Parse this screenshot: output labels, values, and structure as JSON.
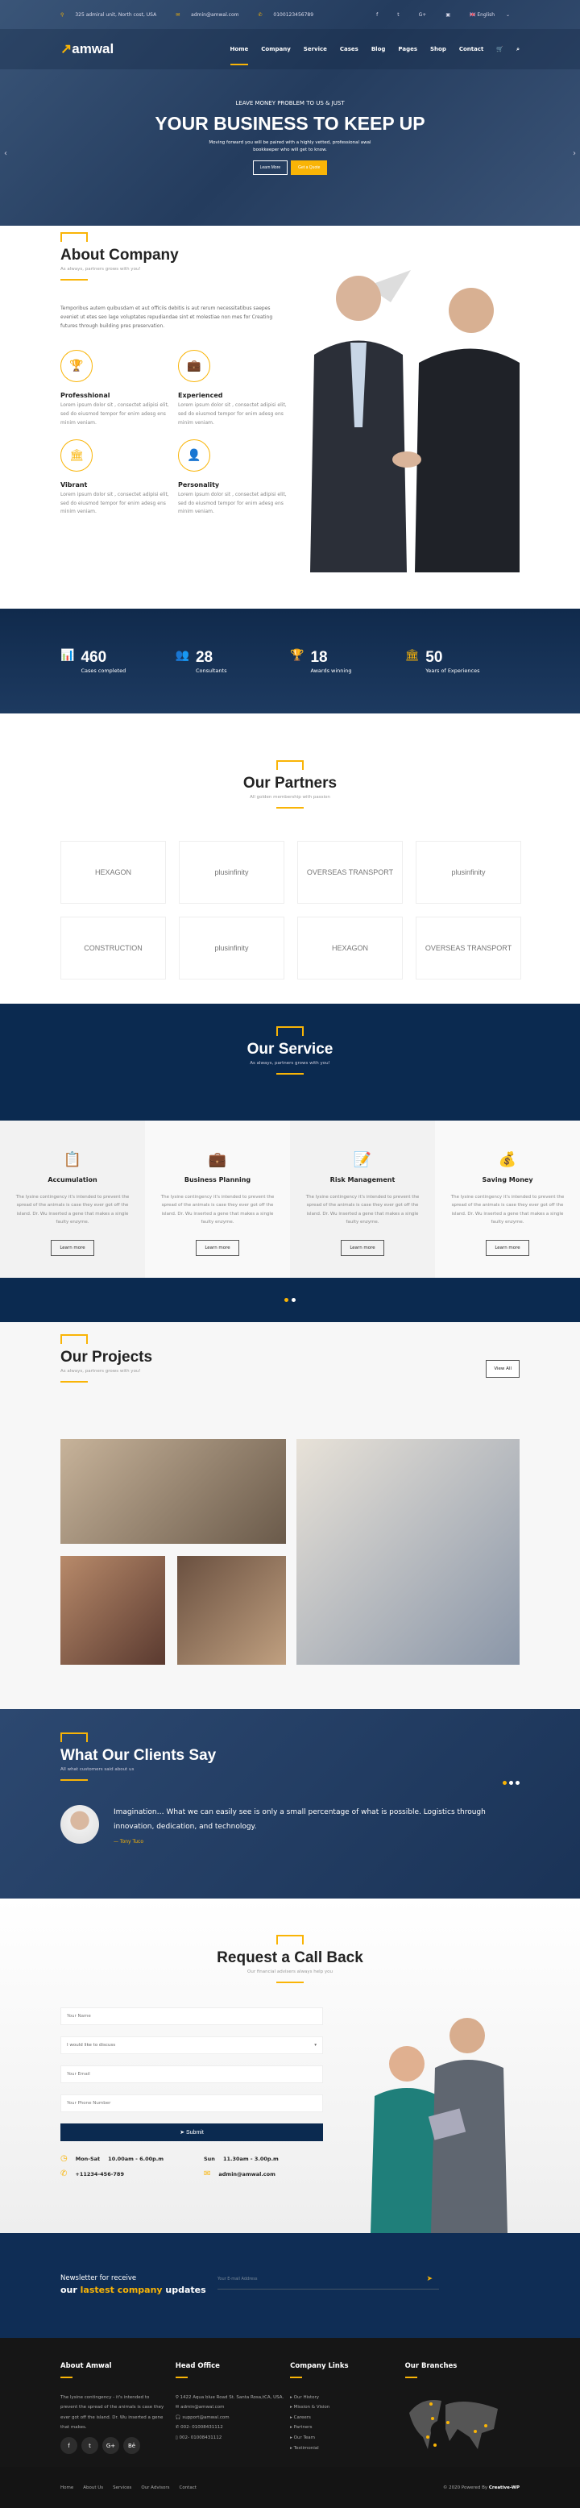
{
  "topbar": {
    "address": "325 admiral unit, North cost, USA",
    "email": "admin@amwal.com",
    "phone": "0100123456789",
    "social": [
      "f",
      "t",
      "G+",
      "▣"
    ],
    "language": "English"
  },
  "nav": {
    "logo": "amwal",
    "items": [
      "Home",
      "Company",
      "Service",
      "Cases",
      "Blog",
      "Pages",
      "Shop",
      "Contact"
    ],
    "active": "Home"
  },
  "hero": {
    "subtitle": "LEAVE MONEY PROBLEM TO US & JUST",
    "title": "YOUR BUSINESS TO KEEP UP",
    "text": "Moving forward you will be paired with a highly vetted, professional awal bookkeeper who will get to know.",
    "btn_learn": "Learn More",
    "btn_quote": "Get a Quote"
  },
  "about": {
    "title": "About Company",
    "subtitle": "As always, partners grows with you!",
    "text": "Temporibus autem quibusdam et aut officiis debitis is aut rerum necessitatibus saepes eveniet ut etes seo lage voluptates repudiandae sint et molestiae non mes for Creating futures through building pres preservation.",
    "features": [
      {
        "icon": "trophy-icon",
        "title": "Professhional",
        "text": "Lorem ipsum dolor sit , consectet adipisi elit, sed do eiusmod tempor for enim adesg ens minim veniam."
      },
      {
        "icon": "briefcase-icon",
        "title": "Experienced",
        "text": "Lorem ipsum dolor sit , consectet adipisi elit, sed do eiusmod tempor for enim adesg ens minim veniam."
      },
      {
        "icon": "bank-icon",
        "title": "Vibrant",
        "text": "Lorem ipsum dolor sit , consectet adipisi elit, sed do eiusmod tempor for enim adesg ens minim veniam."
      },
      {
        "icon": "person-icon",
        "title": "Personality",
        "text": "Lorem ipsum dolor sit , consectet adipisi elit, sed do eiusmod tempor for enim adesg ens minim veniam."
      }
    ]
  },
  "stats": [
    {
      "icon": "chart-icon",
      "value": "460",
      "label": "Cases completed"
    },
    {
      "icon": "users-icon",
      "value": "28",
      "label": "Consultants"
    },
    {
      "icon": "trophy-icon",
      "value": "18",
      "label": "Awards winning"
    },
    {
      "icon": "bank-icon",
      "value": "50",
      "label": "Years of Experiences"
    }
  ],
  "partners": {
    "title": "Our Partners",
    "subtitle": "All golden membership with passion",
    "logos": [
      "HEXAGON",
      "plusinfinity",
      "OVERSEAS TRANSPORT",
      "plusinfinity",
      "CONSTRUCTION",
      "plusinfinity",
      "HEXAGON",
      "OVERSEAS TRANSPORT"
    ]
  },
  "service": {
    "title": "Our Service",
    "subtitle": "As always, partners grows with you!",
    "button": "Learn more",
    "cards": [
      {
        "title": "Accumulation",
        "text": "The lysine contingency it's intended to prevent the spread of the animals is case they ever got off the island. Dr. Wu inserted a gene that makes a single faulty enzyme."
      },
      {
        "title": "Business Planning",
        "text": "The lysine contingency it's intended to prevent the spread of the animals is case they ever got off the island. Dr. Wu inserted a gene that makes a single faulty enzyme."
      },
      {
        "title": "Risk Management",
        "text": "The lysine contingency it's intended to prevent the spread of the animals is case they ever got off the island. Dr. Wu inserted a gene that makes a single faulty enzyme."
      },
      {
        "title": "Saving Money",
        "text": "The lysine contingency it's intended to prevent the spread of the animals is case they ever got off the island. Dr. Wu inserted a gene that makes a single faulty enzyme."
      }
    ]
  },
  "projects": {
    "title": "Our Projects",
    "subtitle": "As always, partners grows with you!",
    "view_all": "View All"
  },
  "clients": {
    "title": "What Our Clients Say",
    "subtitle": "All what customers said about us",
    "quote": "Imagination… What we can easily see is only a small percentage of what is possible. Logistics through innovation, dedication, and technology.",
    "author": "Tony Tuco"
  },
  "request": {
    "title": "Request a Call Back",
    "subtitle": "Our financial advisers always help you",
    "name_ph": "Your Name",
    "discuss": "I would like to discuss",
    "email_ph": "Your Email",
    "phone_ph": "Your Phone Number",
    "submit": "Submit",
    "hours1_day": "Mon-Sat",
    "hours1": "10.00am - 6.00p.m",
    "hours2_day": "Sun",
    "hours2": "11.30am - 3.00p.m",
    "phone": "+11234-456-789",
    "email": "admin@amwal.com"
  },
  "newsletter": {
    "line1": "Newsletter for receive",
    "w1": "our ",
    "w2": "lastest company",
    "w3": " updates",
    "placeholder": "Your E-mail Address"
  },
  "footer": {
    "about_title": "About Amwal",
    "about_text": "The lysine contingency - it's intended to prevent the spread of the animals is case they ever got off the island. Dr. Wu inserted a gene that makes.",
    "social": [
      "f",
      "t",
      "G+",
      "Bē"
    ],
    "office_title": "Head Office",
    "office": [
      "1422 Aqua blue Road St. Santa Rosa,tCA, USA.",
      "admin@amwal.com",
      "support@amwal.com",
      "002- 01008431112",
      "002- 01008431112"
    ],
    "links_title": "Company Links",
    "links": [
      "Our History",
      "Mission & Vision",
      "Careers",
      "Partners",
      "Our Team",
      "Testimonial"
    ],
    "branches_title": "Our Branches"
  },
  "bottom": {
    "links": [
      "Home",
      "About Us",
      "Services",
      "Our Advisors",
      "Contact"
    ],
    "copy": "© 2020 Powered By ",
    "brand": "Creative-WP"
  },
  "colors": {
    "accent": "#f9b406",
    "navy": "#0b2a50",
    "footer": "#161616"
  }
}
